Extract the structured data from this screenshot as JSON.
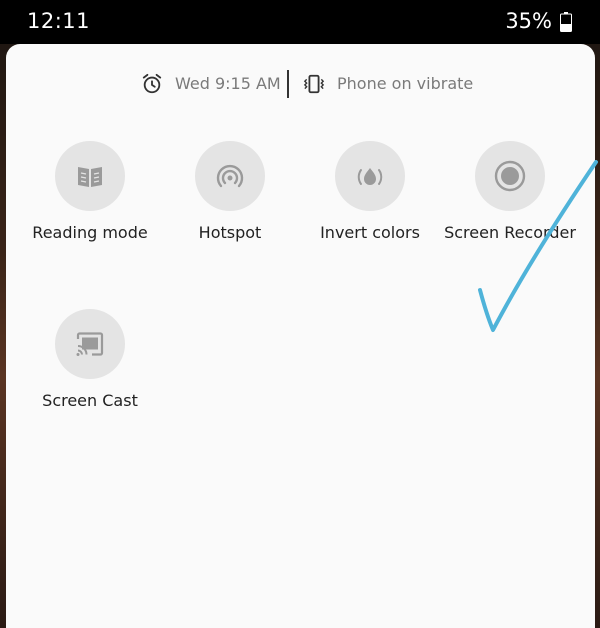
{
  "status_bar": {
    "time": "12:11",
    "battery": "35%"
  },
  "info_row": {
    "alarm": "Wed 9:15 AM",
    "ringer": "Phone on vibrate"
  },
  "tiles": [
    {
      "label": "Reading mode",
      "icon": "book-icon"
    },
    {
      "label": "Hotspot",
      "icon": "hotspot-icon"
    },
    {
      "label": "Invert colors",
      "icon": "invert-colors-icon"
    },
    {
      "label": "Screen Recorder",
      "icon": "record-icon"
    },
    {
      "label": "Screen Cast",
      "icon": "cast-icon"
    }
  ],
  "colors": {
    "panel_bg": "#fafafa",
    "tile_bg": "#e4e4e4",
    "icon": "#9a9a9a",
    "annotation": "#4fb3d9"
  }
}
